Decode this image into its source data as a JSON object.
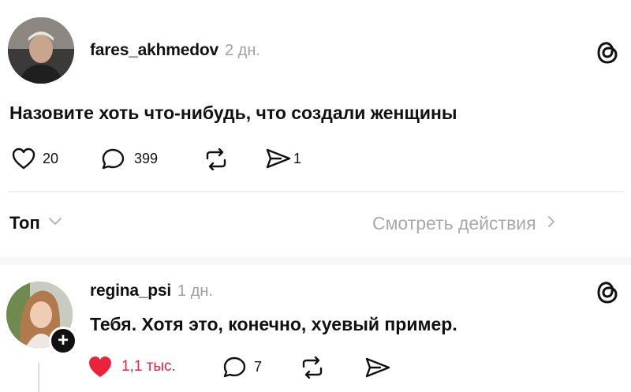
{
  "post": {
    "author": "fares_akhmedov",
    "time": "2 дн.",
    "text": "Назовите хоть что-нибудь, что создали женщины",
    "likes": "20",
    "comments": "399",
    "shares": "1"
  },
  "replies_header": {
    "sort_label": "Топ",
    "activity_link": "Смотреть действия"
  },
  "reply": {
    "author": "regina_psi",
    "time": "1 дн.",
    "text": "Тебя. Хотя это, конечно, хуевый пример.",
    "likes": "1,1 тыс.",
    "comments": "7"
  },
  "colors": {
    "like_active": "#e8233b",
    "muted": "#a0a0a0"
  },
  "icons": [
    "threads-icon",
    "heart-icon",
    "comment-icon",
    "repost-icon",
    "share-icon",
    "chevron-down-icon",
    "chevron-right-icon",
    "plus-icon"
  ]
}
